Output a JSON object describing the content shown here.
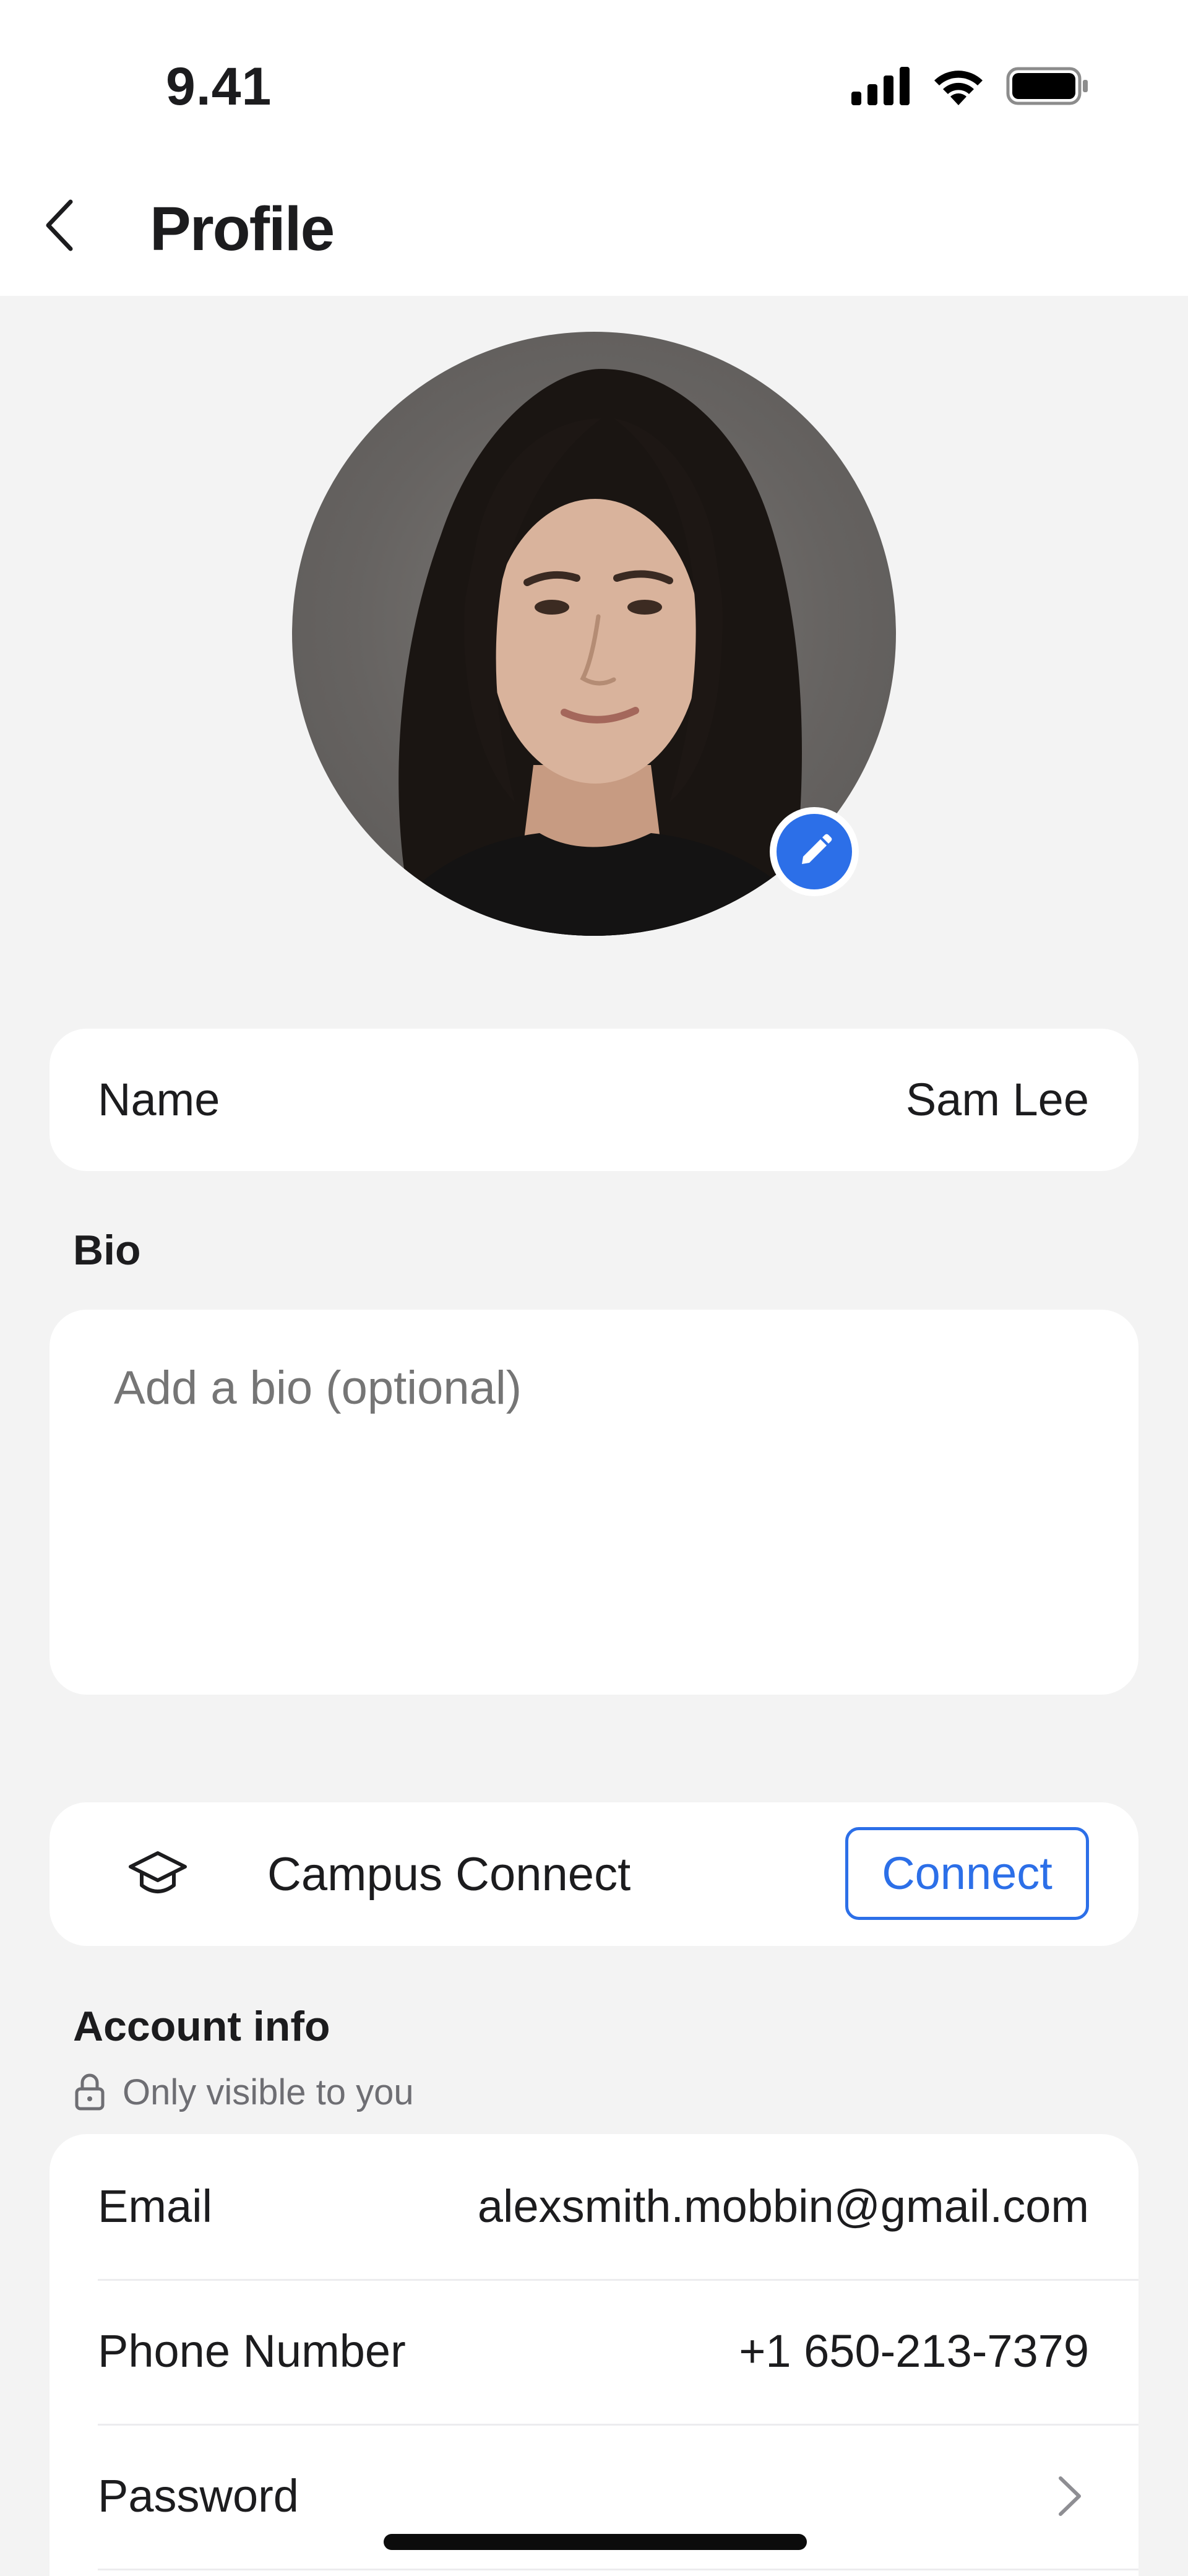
{
  "status_bar": {
    "time": "9.41",
    "icons": [
      "cellular-signal-icon",
      "wifi-icon",
      "battery-icon"
    ]
  },
  "nav": {
    "back_icon": "chevron-left-icon",
    "title": "Profile"
  },
  "avatar": {
    "edit_icon": "pencil-icon",
    "accent_color": "#2c6fe8"
  },
  "name_row": {
    "label": "Name",
    "value": "Sam Lee"
  },
  "bio": {
    "label": "Bio",
    "placeholder": "Add a bio (optional)",
    "value": ""
  },
  "campus": {
    "icon": "graduation-cap-icon",
    "label": "Campus Connect",
    "button_label": "Connect"
  },
  "account_info": {
    "title": "Account info",
    "note_icon": "lock-icon",
    "note": "Only visible to you",
    "rows": [
      {
        "label": "Email",
        "value": "alexsmith.mobbin@gmail.com"
      },
      {
        "label": "Phone Number",
        "value": "+1 650-213-7379"
      },
      {
        "label": "Password",
        "value": "",
        "icon": "chevron-right-icon"
      }
    ]
  },
  "colors": {
    "background": "#f3f3f3",
    "card": "#ffffff",
    "accent": "#2c6fe8",
    "placeholder": "#b8b8bb",
    "secondary_text": "#6e6e73"
  }
}
